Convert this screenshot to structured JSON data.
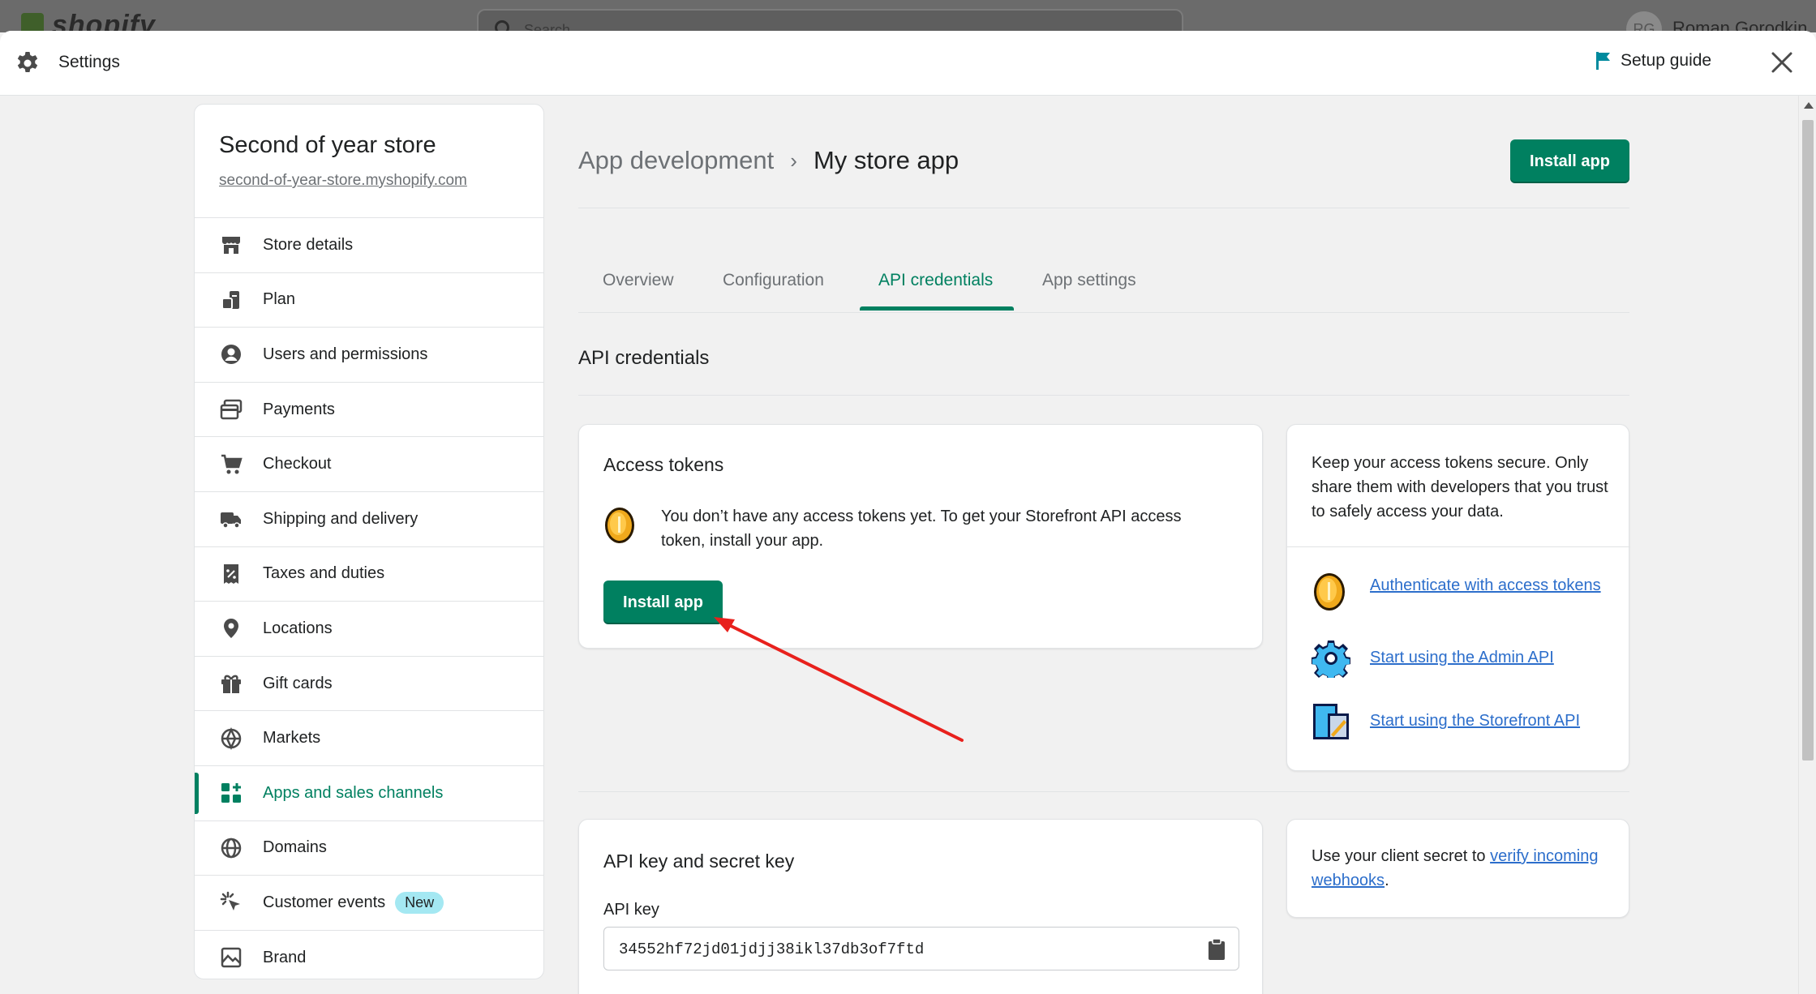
{
  "backdrop": {
    "logo_text": "shopify",
    "search_placeholder": "Search",
    "avatar_initials": "RG",
    "user_name": "Roman Gorodkin"
  },
  "header": {
    "title": "Settings",
    "setup_guide": "Setup guide"
  },
  "store": {
    "name": "Second of year store",
    "url": "second-of-year-store.myshopify.com"
  },
  "sidebar": {
    "items": [
      {
        "label": "Store details",
        "icon": "store-icon"
      },
      {
        "label": "Plan",
        "icon": "plan-icon"
      },
      {
        "label": "Users and permissions",
        "icon": "user-icon"
      },
      {
        "label": "Payments",
        "icon": "payments-icon"
      },
      {
        "label": "Checkout",
        "icon": "cart-icon"
      },
      {
        "label": "Shipping and delivery",
        "icon": "truck-icon"
      },
      {
        "label": "Taxes and duties",
        "icon": "tax-icon"
      },
      {
        "label": "Locations",
        "icon": "location-icon"
      },
      {
        "label": "Gift cards",
        "icon": "gift-icon"
      },
      {
        "label": "Markets",
        "icon": "globe-icon"
      },
      {
        "label": "Apps and sales channels",
        "icon": "apps-icon",
        "active": true
      },
      {
        "label": "Domains",
        "icon": "globe-icon"
      },
      {
        "label": "Customer events",
        "icon": "cursor-click-icon",
        "badge": "New"
      },
      {
        "label": "Brand",
        "icon": "brand-icon"
      }
    ]
  },
  "breadcrumb": {
    "parent": "App development",
    "current": "My store app"
  },
  "top_button": "Install app",
  "tabs": [
    "Overview",
    "Configuration",
    "API credentials",
    "App settings"
  ],
  "active_tab": "API credentials",
  "section_title": "API credentials",
  "access_tokens": {
    "title": "Access tokens",
    "message": "You don’t have any access tokens yet. To get your Storefront API access token, install your app.",
    "button": "Install app"
  },
  "info_card": {
    "text": "Keep your access tokens secure. Only share them with developers that you trust to safely access your data.",
    "links": [
      {
        "label": "Authenticate with access tokens",
        "icon": "coin-icon"
      },
      {
        "label": "Start using the Admin API",
        "icon": "gear-pixel-icon"
      },
      {
        "label": "Start using the Storefront API",
        "icon": "storefront-icon"
      }
    ]
  },
  "api_keys": {
    "title": "API key and secret key",
    "api_key_label": "API key",
    "api_key_value": "34552hf72jd01jdjj38ikl37db3of7ftd"
  },
  "webhook_card": {
    "prefix": "Use your client secret to ",
    "link": "verify incoming webhooks",
    "suffix": "."
  },
  "colors": {
    "accent": "#008060",
    "link": "#2c6ecb",
    "annotation_arrow": "#e8211d",
    "badge_bg": "#a4e8f2"
  }
}
